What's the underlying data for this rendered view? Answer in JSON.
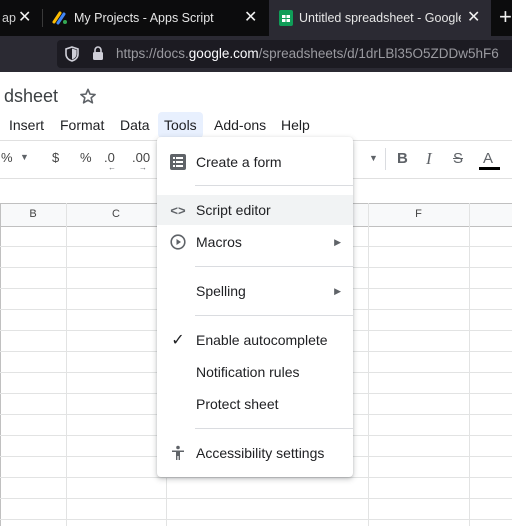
{
  "browser": {
    "tabs": [
      {
        "title": "ap",
        "active": false
      },
      {
        "title": "My Projects - Apps Script",
        "active": false
      },
      {
        "title": "Untitled spreadsheet - Google S",
        "active": true
      }
    ],
    "new_tab_label": "+",
    "url_prefix": "https://docs.",
    "url_host": "google.com",
    "url_path": "/spreadsheets/d/1drLBl35O5ZDDw5hF6"
  },
  "sheets": {
    "doc_title": "dsheet",
    "menu": [
      "Insert",
      "Format",
      "Data",
      "Tools",
      "Add-ons",
      "Help"
    ],
    "toolbar": {
      "percent_cut": "%",
      "currency": "$",
      "percent": "%",
      "dec_less": ".0",
      "dec_more": ".00"
    },
    "columns": [
      "B",
      "C",
      "F"
    ]
  },
  "tools_menu": {
    "items": [
      {
        "label": "Create a form",
        "icon": "form-icon"
      },
      {
        "label": "Script editor",
        "icon": "code-icon"
      },
      {
        "label": "Macros",
        "icon": "play-circle-icon",
        "submenu": true
      },
      {
        "label": "Spelling",
        "submenu": true
      },
      {
        "label": "Enable autocomplete",
        "icon": "check-icon"
      },
      {
        "label": "Notification rules"
      },
      {
        "label": "Protect sheet"
      },
      {
        "label": "Accessibility settings",
        "icon": "accessibility-icon"
      }
    ]
  },
  "colors": {
    "accent_green": "#188038",
    "menu_active_bg": "#e8f0fe",
    "tab_bg_active": "#2b2a33"
  }
}
